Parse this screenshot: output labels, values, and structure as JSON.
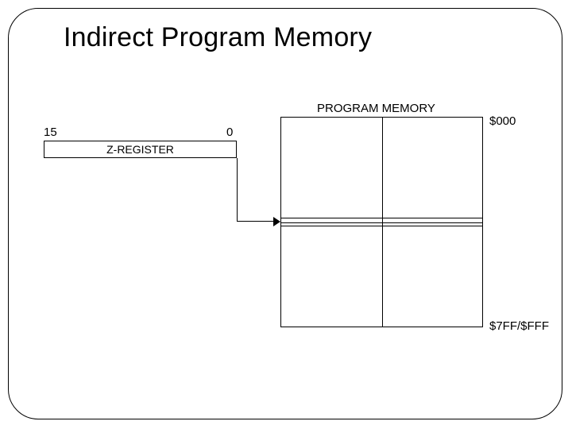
{
  "title": "Indirect Program Memory",
  "register": {
    "label": "Z-REGISTER",
    "high_bit": "15",
    "low_bit": "0"
  },
  "memory": {
    "label": "PROGRAM MEMORY",
    "start_addr": "$000",
    "end_addr": "$7FF/$FFF"
  }
}
